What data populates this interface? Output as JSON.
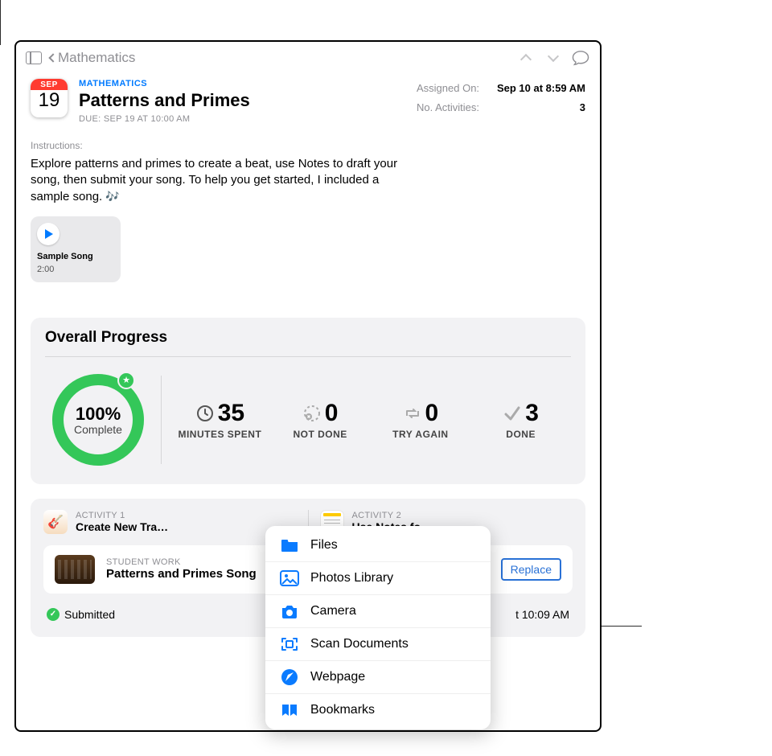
{
  "topbar": {
    "back_label": "Mathematics"
  },
  "header": {
    "calendar_month": "SEP",
    "calendar_day": "19",
    "category": "MATHEMATICS",
    "title": "Patterns and Primes",
    "due": "DUE: SEP 19 AT 10:00 AM"
  },
  "meta": {
    "assigned_label": "Assigned On:",
    "assigned_value": "Sep 10 at 8:59 AM",
    "activities_label": "No. Activities:",
    "activities_value": "3"
  },
  "instructions": {
    "label": "Instructions:",
    "text": "Explore patterns and primes to create a beat, use Notes to draft your song, then submit your song. To help you get started, I included a sample song."
  },
  "media": {
    "title": "Sample Song",
    "duration": "2:00"
  },
  "progress": {
    "title": "Overall Progress",
    "percent": "100%",
    "sub": "Complete",
    "stats": [
      {
        "value": "35",
        "label": "MINUTES SPENT",
        "icon": "clock"
      },
      {
        "value": "0",
        "label": "NOT DONE",
        "icon": "x-circle"
      },
      {
        "value": "0",
        "label": "TRY AGAIN",
        "icon": "redo"
      },
      {
        "value": "3",
        "label": "DONE",
        "icon": "check"
      }
    ]
  },
  "activities": [
    {
      "label": "ACTIVITY 1",
      "title": "Create New Tra…",
      "app": "garageband"
    },
    {
      "label": "ACTIVITY 2",
      "title": "Use Notes fo",
      "app": "notes"
    }
  ],
  "student_work": {
    "label": "STUDENT WORK",
    "title": "Patterns and Primes Song",
    "replace_label": "Replace",
    "status": "Submitted",
    "status_time": "10:09 AM",
    "status_time_prefix": "t"
  },
  "popup": {
    "items": [
      {
        "icon": "folder",
        "label": "Files"
      },
      {
        "icon": "photo",
        "label": "Photos Library"
      },
      {
        "icon": "camera",
        "label": "Camera"
      },
      {
        "icon": "scan",
        "label": "Scan Documents"
      },
      {
        "icon": "safari",
        "label": "Webpage"
      },
      {
        "icon": "bookmark",
        "label": "Bookmarks"
      }
    ]
  }
}
